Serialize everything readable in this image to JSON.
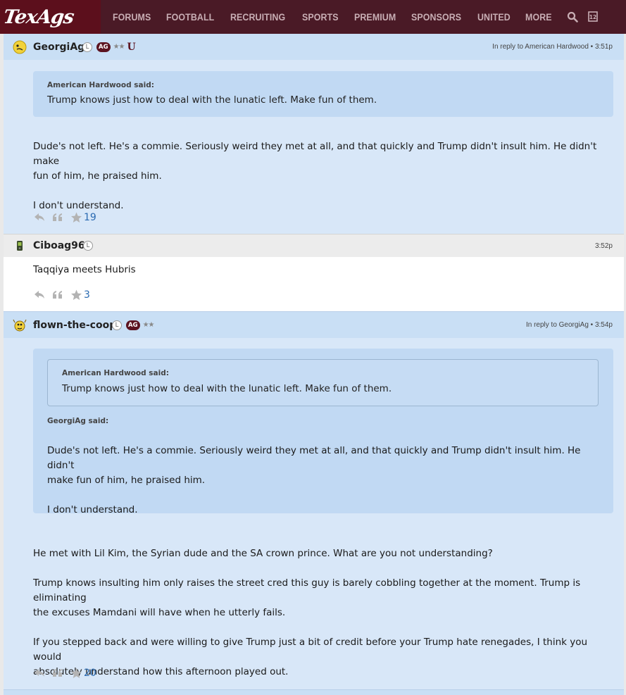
{
  "nav": {
    "logo": "TexAgs",
    "items": [
      "FORUMS",
      "FOOTBALL",
      "RECRUITING",
      "SPORTS",
      "PREMIUM",
      "SPONSORS",
      "UNITED",
      "MORE"
    ],
    "search_icon": "search-icon",
    "twelfth_icon": "twelve-icon"
  },
  "posts": [
    {
      "author": "GeorgiAg",
      "badge_l": "L",
      "badge_ag": "AG",
      "badge_stars": "★★",
      "badge_u": "U",
      "meta": "In reply to American Hardwood • 3:51p",
      "quote_author": "American Hardwood said:",
      "quote_text": "Trump knows just how to deal with the lunatic left. Make fun of them.",
      "body": [
        "Dude's not left. He's a commie. Seriously weird they met at all, and that quickly and Trump didn't insult him. He didn't make",
        "fun of him, he praised him.",
        "I don't understand."
      ],
      "stars": "19"
    },
    {
      "author": "Ciboag96",
      "badge_l": "L",
      "meta": "3:52p",
      "body": [
        "Taqqiya meets Hubris"
      ],
      "stars": "3"
    },
    {
      "author": "flown-the-coop",
      "badge_l": "L",
      "badge_ag": "AG",
      "badge_stars": "★★",
      "meta": "In reply to GeorgiAg • 3:54p",
      "nested_quote_author": "American Hardwood said:",
      "nested_quote_text": "Trump knows just how to deal with the lunatic left. Make fun of them.",
      "quote_author": "GeorgiAg said:",
      "quote_body": [
        "Dude's not left. He's a commie. Seriously weird they met at all, and that quickly and Trump didn't insult him. He didn't",
        "make fun of him, he praised him.",
        "I don't understand."
      ],
      "body": [
        "He met with Lil Kim, the Syrian dude and the SA crown prince. What are you not understanding?",
        "Trump knows insulting him only raises the street cred this guy is barely cobbling together at the moment. Trump is eliminating",
        "the excuses Mamdani will have when he utterly fails.",
        "If you stepped back and were willing to give Trump just a bit of credit before your Trump hate renegades, I think you would",
        "absolutely understand how this afternoon played out."
      ],
      "stars": "20"
    }
  ],
  "colors": {
    "nav_bg": "#4a1a26",
    "maroon": "#5c0f1c",
    "post_blue": "#d8e7f8",
    "link_blue": "#2a6ab1"
  }
}
